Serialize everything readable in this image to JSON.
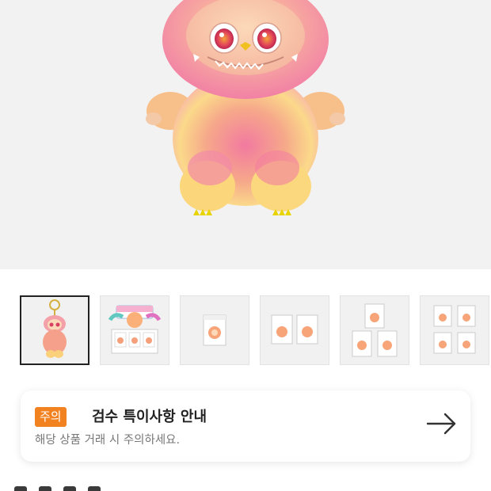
{
  "product": {
    "image_icon": "plush-figure-hero",
    "thumbnails": [
      {
        "icon": "keychain-plush-thumbnail",
        "selected": true
      },
      {
        "icon": "display-box-set-thumbnail",
        "selected": false
      },
      {
        "icon": "single-box-thumbnail",
        "selected": false
      },
      {
        "icon": "two-boxes-thumbnail",
        "selected": false
      },
      {
        "icon": "three-boxes-thumbnail",
        "selected": false
      },
      {
        "icon": "four-boxes-thumbnail",
        "selected": false
      }
    ]
  },
  "notice": {
    "badge": "주의",
    "title": "검수 특이사항 안내",
    "subtitle": "해당 상품 거래 시 주의하세요.",
    "arrow_icon": "arrow-right-icon"
  },
  "colors": {
    "badge": "#f2811f",
    "hero_bg": "#f2f2f2"
  }
}
